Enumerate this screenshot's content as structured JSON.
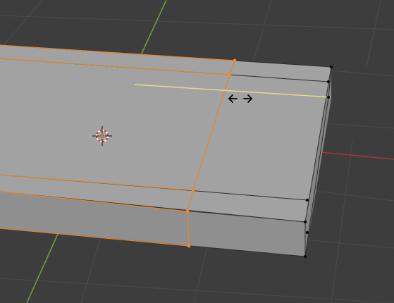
{
  "viewport": {
    "background": "#3d3d3d",
    "grid_color": "#4a4a4a",
    "y_axis_color": "#6f9a3a",
    "x_axis_color": "#a8323e"
  },
  "mesh": {
    "top_face_color": "#a2a2a2",
    "front_face_color": "#8f8f8f",
    "side_face_color": "#858585",
    "edge_color": "#2e2e2e",
    "selected_edge_color": "#e8852a",
    "selected_vertex_color": "#f28c1a",
    "vertex_color": "#0d0d0d",
    "preview_edge_color": "#e6d98a"
  },
  "cursor": {
    "icon": "horizontal-slide-arrows-icon",
    "glyph": "↔"
  },
  "origin": {
    "icon": "3d-cursor-icon"
  }
}
